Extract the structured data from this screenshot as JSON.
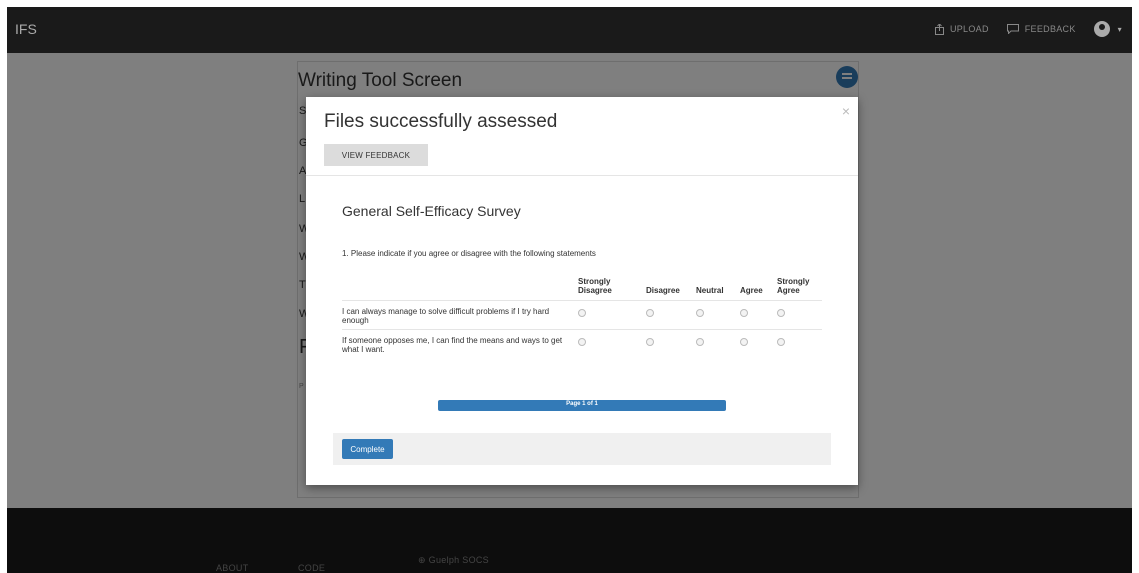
{
  "navbar": {
    "brand": "IFS",
    "upload_label": "UPLOAD",
    "feedback_label": "FEEDBACK"
  },
  "page": {
    "title": "Writing Tool Screen",
    "bg_letters": [
      "S",
      "G",
      "A",
      "L",
      "W",
      "W",
      "T",
      "W"
    ],
    "bg_big": "F",
    "bg_small": "P"
  },
  "modal": {
    "title": "Files successfully assessed",
    "view_feedback_label": "VIEW FEEDBACK",
    "close_symbol": "×"
  },
  "survey": {
    "title": "General Self-Efficacy Survey",
    "question": "1. Please indicate if you agree or disagree with the following statements",
    "columns": [
      "Strongly Disagree",
      "Disagree",
      "Neutral",
      "Agree",
      "Strongly Agree"
    ],
    "rows": [
      "I can always manage to solve difficult problems if I try hard enough",
      "If someone opposes me, I can find the means and ways to get what I want."
    ],
    "progress_text": "Page 1 of 1",
    "progress": 1.0,
    "complete_label": "Complete"
  },
  "footer": {
    "about": "ABOUT",
    "code": "CODE",
    "socs": "Guelph SOCS"
  },
  "colors": {
    "accent": "#337ab7",
    "navbar": "#1a1a1a"
  }
}
